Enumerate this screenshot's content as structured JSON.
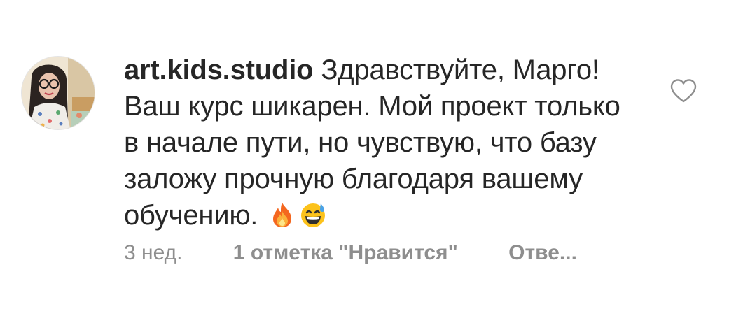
{
  "comment": {
    "username": "art.kids.studio",
    "text": "Здравствуйте, Марго! Ваш курс шикарен. Мой проект только в начале пути, но чувствую, что базу заложу прочную благодаря вашему обучению.",
    "emojis": [
      "fire-emoji",
      "grinning-sweat-emoji"
    ],
    "time": "3 нед.",
    "likes": "1 отметка \"Нравится\"",
    "reply": "Отве..."
  },
  "colors": {
    "text": "#262626",
    "secondary_text": "#8e8e8e",
    "background": "#ffffff"
  },
  "icons": {
    "like": "heart-outline-icon",
    "avatar": "user-avatar-photo"
  }
}
